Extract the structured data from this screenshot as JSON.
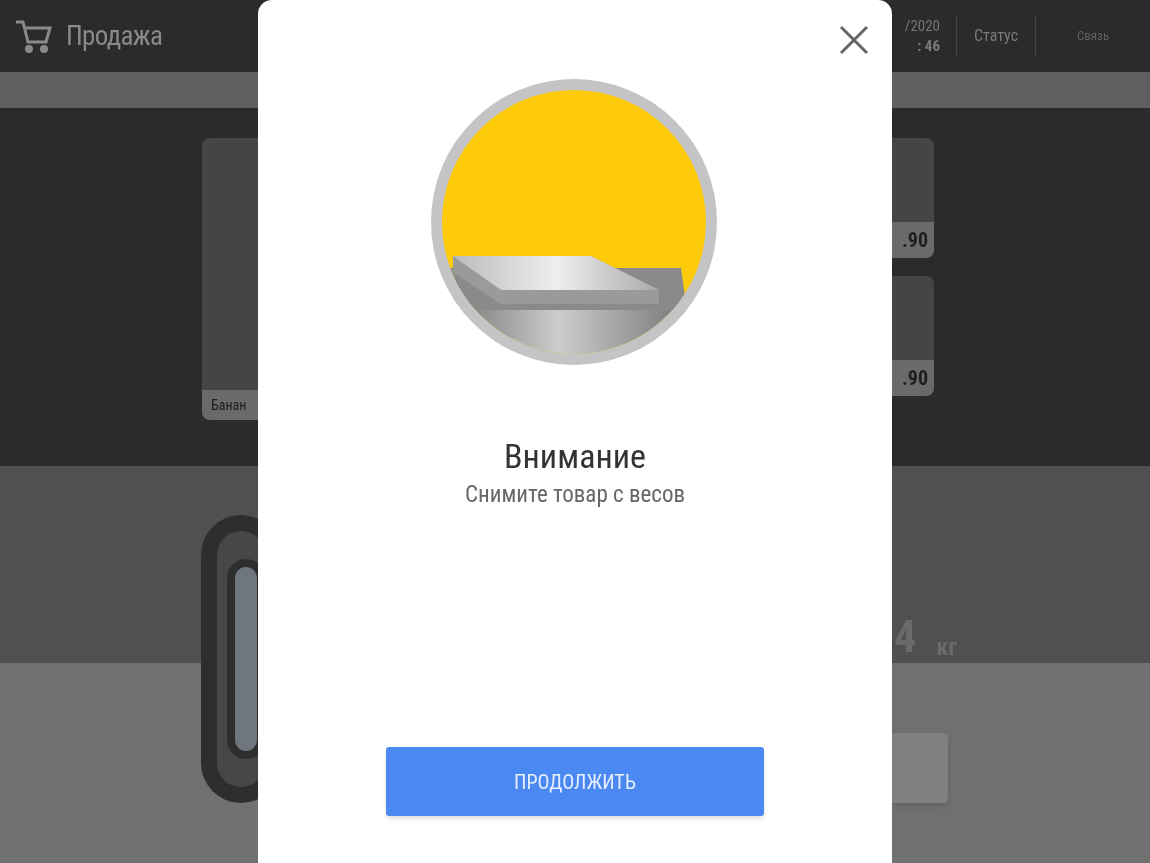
{
  "header": {
    "title": "Продажа",
    "date": "/2020",
    "time": ": 46",
    "status": "Статус",
    "connection": "Связь"
  },
  "products": {
    "left_name": "Банан",
    "right_prices": [
      ".90",
      ".90"
    ]
  },
  "weight": {
    "value": "4",
    "unit": "кг"
  },
  "dialog": {
    "title": "Внимание",
    "message": "Снимите товар с весов",
    "button": "ПРОДОЛЖИТЬ"
  }
}
